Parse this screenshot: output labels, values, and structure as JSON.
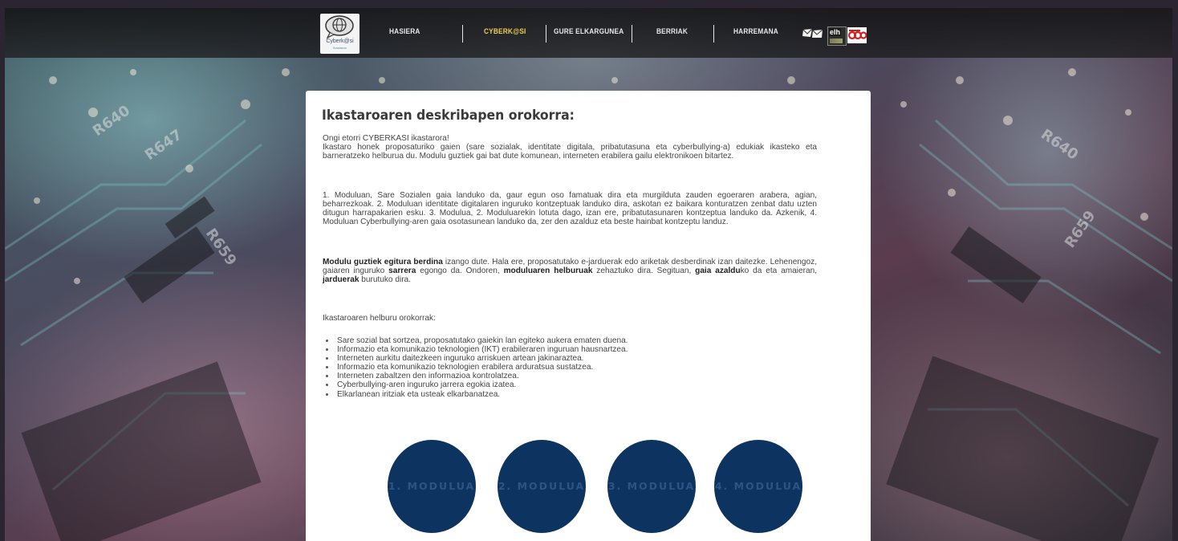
{
  "brand": {
    "logo_text": "Cyberk@si",
    "logo_subtext": "Ikastaroa"
  },
  "nav": {
    "items": [
      {
        "label": "HASIERA",
        "active": false
      },
      {
        "label": "CYBERK@SI",
        "active": true
      },
      {
        "label": "GURE ELKARGUNEA",
        "active": false
      },
      {
        "label": "BERRIAK",
        "active": false
      },
      {
        "label": "HARREMANA",
        "active": false
      }
    ],
    "icons": [
      "mail-icon",
      "elh-icon",
      "red-logo-icon"
    ],
    "elh_label": "elh"
  },
  "content": {
    "title": "Ikastaroaren deskribapen orokorra:",
    "intro_line1": "Ongi etorri CYBERKASI ikastarora!",
    "intro_body": "Ikastaro honek proposaturiko gaien (sare sozialak, identitate digitala, pribatutasuna eta cyberbullying-a) edukiak ikasteko eta barneratzeko helburua du. Modulu guztiek gai bat dute komunean, interneten erabilera gailu elektronikoen bitartez.",
    "modules_paragraph": "1. Moduluan, Sare Sozialen gaia landuko da, gaur egun oso famatuak dira eta murgilduta zauden egoeraren arabera, agian, beharrezkoak. 2. Moduluan identitate digitalaren inguruko kontzeptuak landuko dira, askotan ez baikara konturatzen zenbat datu uzten ditugun harrapakarien esku. 3. Modulua, 2. Moduluarekin lotuta dago, izan ere, pribatutasunaren kontzeptua landuko da. Azkenik, 4. Moduluan Cyberbullying-aren gaia osotasunean landuko da, zer den azalduz eta beste hainbat kontzeptu landuz.",
    "structure": {
      "s1": "Modulu guztiek egitura berdina",
      "s2": " izango dute. Hala ere, proposatutako e-jarduerak edo ariketak desberdinak izan daitezke. Lehenengoz, gaiaren inguruko ",
      "s3": "sarrera",
      "s4": " egongo da. Ondoren, ",
      "s5": "moduluaren helburuak",
      "s6": " zehaztuko dira. Segituan, ",
      "s7": "gaia azaldu",
      "s8": "ko da eta amaieran, ",
      "s9": "jarduerak",
      "s10": " burutuko dira."
    },
    "objectives_heading": "Ikastaroaren helburu orokorrak:",
    "objectives": [
      "Sare sozial bat sortzea, proposatutako gaiekin lan egiteko aukera ematen duena.",
      "Informazio eta komunikazio teknologien (IKT) erabileraren inguruan hausnartzea.",
      "Interneten aurkitu daitezkeen inguruko arriskuen artean jakinaraztea.",
      "Informazio eta komunikazio teknologien erabilera arduratsua sustatzea.",
      "Interneten zabaltzen den informazioa kontrolatzea.",
      "Cyberbullying-aren inguruko jarrera egokia izatea.",
      "Elkarlanean iritziak eta usteak elkarbanatzea."
    ]
  },
  "modules": [
    {
      "label": "1. MODULUA"
    },
    {
      "label": "2. MODULUA"
    },
    {
      "label": "3. MODULUA"
    },
    {
      "label": "4. MODULUA"
    }
  ],
  "colors": {
    "module_circle": "#0d3460",
    "module_label": "#2d5484",
    "nav_active": "#f0d050",
    "navbar_bg": "#1e1e20"
  }
}
